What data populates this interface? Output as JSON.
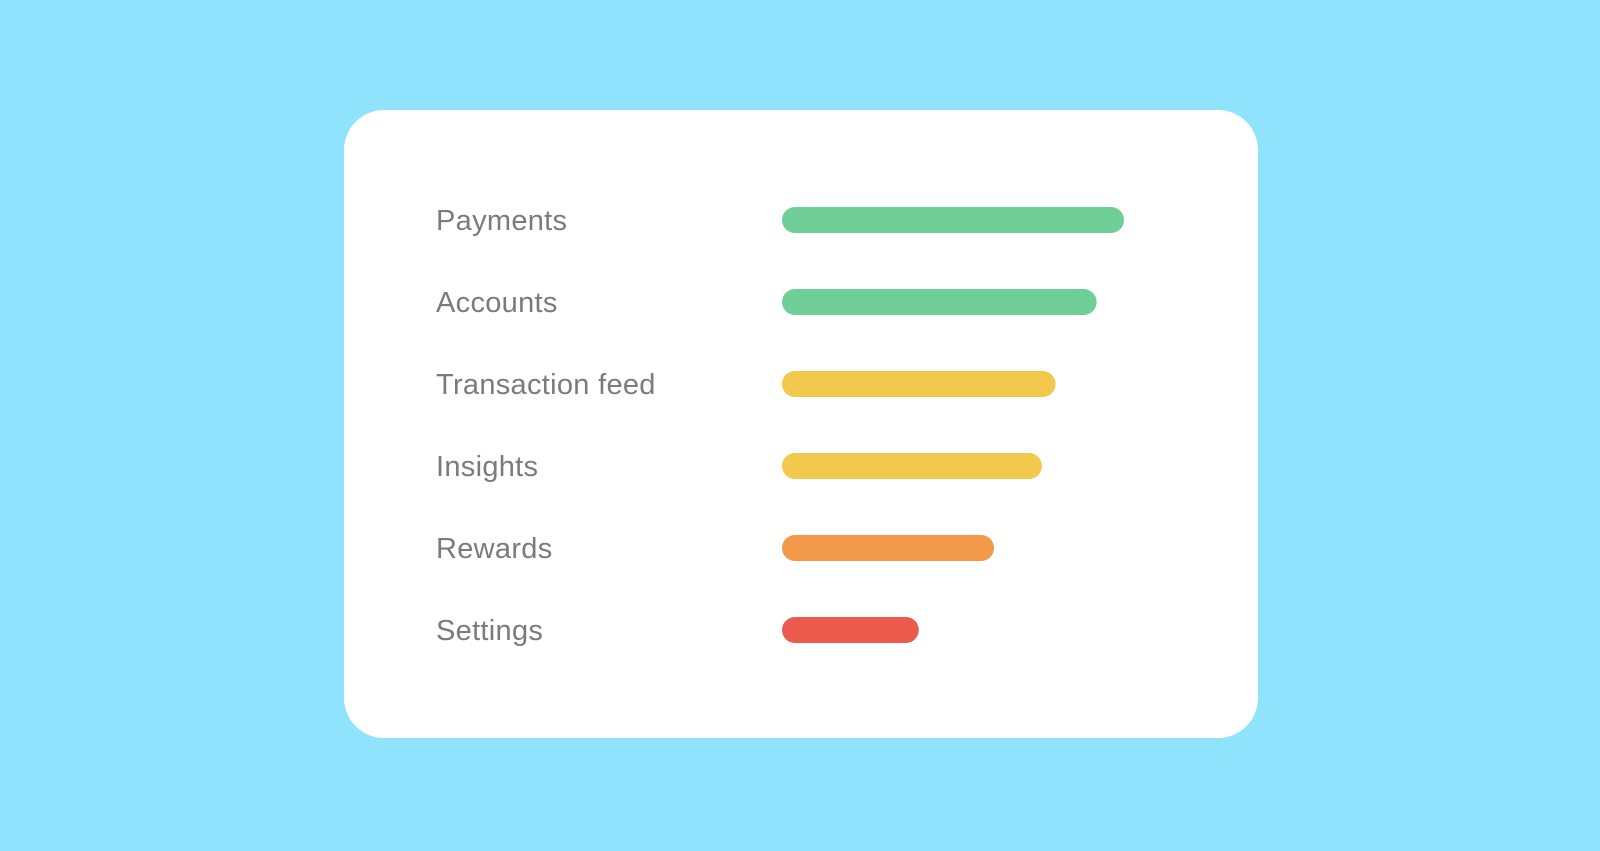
{
  "chart_data": {
    "type": "bar",
    "orientation": "horizontal",
    "categories": [
      "Payments",
      "Accounts",
      "Transaction feed",
      "Insights",
      "Rewards",
      "Settings"
    ],
    "values": [
      100,
      92,
      80,
      76,
      62,
      40
    ],
    "colors": [
      "#6fcf97",
      "#6fcf97",
      "#f2c94c",
      "#f2c94c",
      "#f2994a",
      "#eb5b4b"
    ],
    "xlim": [
      0,
      100
    ],
    "title": "",
    "xlabel": "",
    "ylabel": "",
    "grid": false,
    "legend": "none"
  },
  "colors": {
    "background": "#8fe3fd",
    "card": "#ffffff",
    "label_text": "#7b7b7b"
  }
}
